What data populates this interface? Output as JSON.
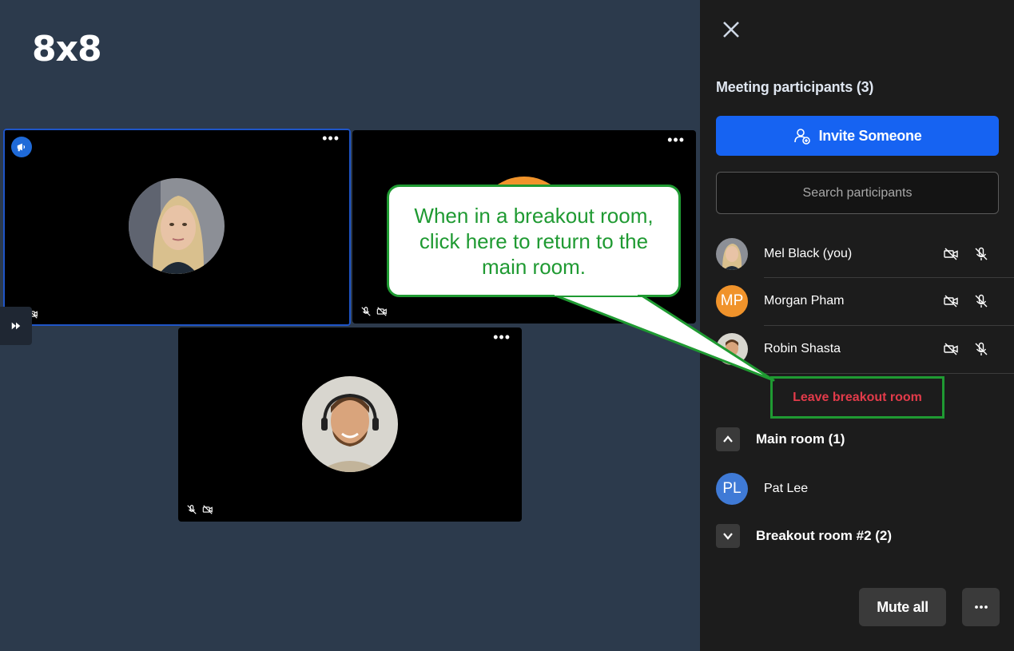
{
  "logo": "8x8",
  "tiles": [
    {
      "name": "Mel Black",
      "menu": "•••"
    },
    {
      "name": "Morgan Pham",
      "menu": "•••"
    },
    {
      "name": "Robin Shasta",
      "menu": "•••"
    }
  ],
  "panel": {
    "title": "Meeting participants (3)",
    "invite_label": "Invite Someone",
    "search_placeholder": "Search participants",
    "participants": [
      {
        "name": "Mel Black (you)",
        "initials": "",
        "avatar_color": "#c9c2b8"
      },
      {
        "name": "Morgan Pham",
        "initials": "MP",
        "avatar_color": "#f0932b"
      },
      {
        "name": "Robin Shasta",
        "initials": "",
        "avatar_color": "#8a7a6a"
      }
    ],
    "leave_label": "Leave breakout room",
    "main_room_label": "Main room (1)",
    "main_room_participants": [
      {
        "name": "Pat Lee",
        "initials": "PL",
        "avatar_color": "#3f7ad6"
      }
    ],
    "breakout_room_label": "Breakout room #2 (2)",
    "mute_all_label": "Mute all"
  },
  "callout": {
    "text": "When in a breakout room, click here to return to the main room."
  },
  "colors": {
    "stage_bg": "#2c3a4c",
    "panel_bg": "#1c1c1c",
    "accent_blue": "#1663f2",
    "callout_green": "#1f9a32",
    "leave_red": "#e23b4a"
  }
}
